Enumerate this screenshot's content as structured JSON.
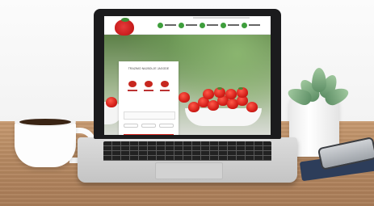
{
  "scene": {
    "objects": [
      "laptop",
      "coffee-mug",
      "succulent-plant",
      "smartphone",
      "notebook"
    ]
  },
  "website": {
    "card_title": "TRAŻIMO NAJBOLJE JAGODE"
  },
  "colors": {
    "brand_red": "#d7261e",
    "nav_green": "#3e9e3c",
    "desk_wood": "#b58861"
  }
}
